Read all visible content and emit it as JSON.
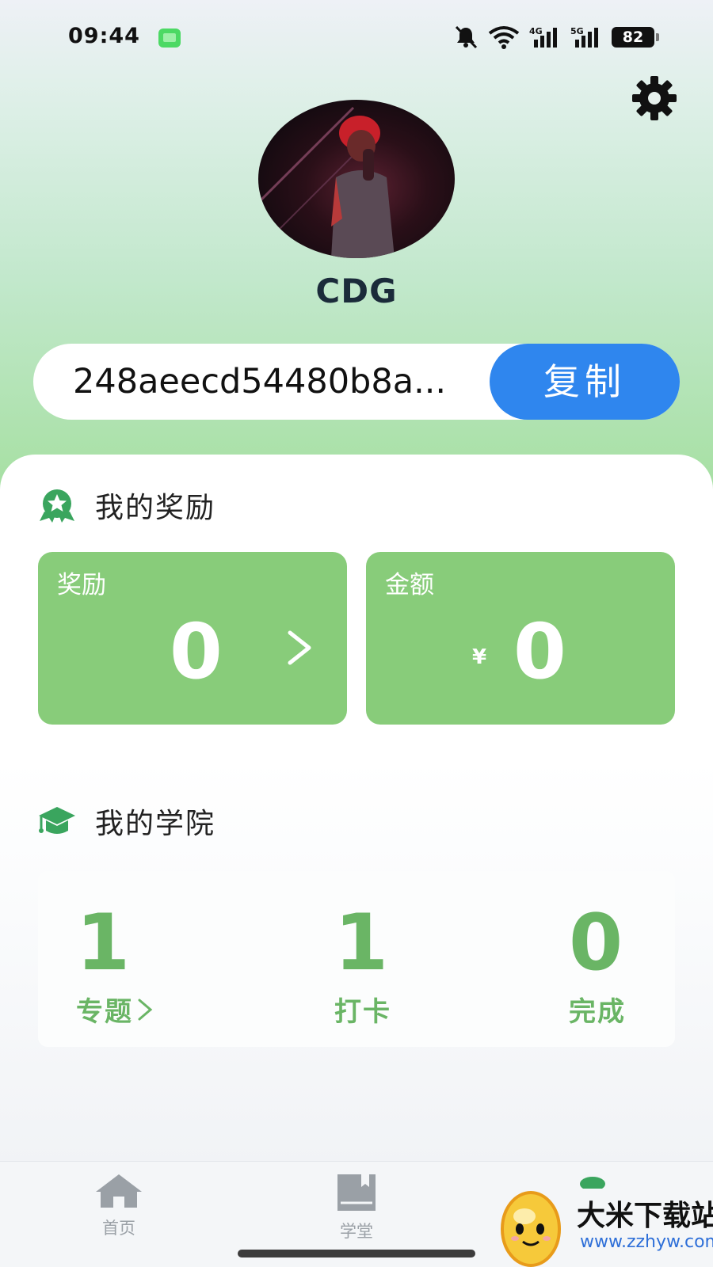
{
  "status_bar": {
    "time": "09:44",
    "battery": "82",
    "network_1": "4G",
    "network_2": "5G"
  },
  "profile": {
    "username": "CDG",
    "user_id": "248aeecd54480b8a...",
    "copy_label": "复制"
  },
  "rewards": {
    "title": "我的奖励",
    "reward_label": "奖励",
    "reward_value": "0",
    "amount_label": "金额",
    "currency_symbol": "¥",
    "amount_value": "0"
  },
  "academy": {
    "title": "我的学院",
    "stats": [
      {
        "value": "1",
        "label": "专题"
      },
      {
        "value": "1",
        "label": "打卡"
      },
      {
        "value": "0",
        "label": "完成"
      }
    ]
  },
  "bottom_nav": {
    "items": [
      {
        "label": "首页"
      },
      {
        "label": "学堂"
      }
    ]
  },
  "watermark": {
    "title": "大米下载站",
    "url": "www.zzhyw.com"
  },
  "colors": {
    "accent_blue": "#2f86ee",
    "card_green": "#88cc7a",
    "stat_green": "#6ab565",
    "icon_green": "#3aa55e"
  }
}
